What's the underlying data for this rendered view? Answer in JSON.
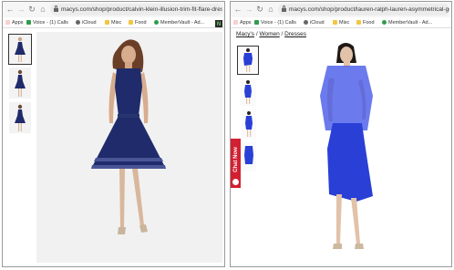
{
  "left_window": {
    "url": "macys.com/shop/product/calvin-klein-illusion-trim-fit-flare-dress",
    "bookmarks": {
      "apps": "Apps",
      "voice": "Voice - (1) Calls",
      "icloud": "iCloud",
      "misc": "Misc",
      "food": "Food",
      "membervault": "MemberVault - Ad..."
    },
    "extension_badge": "N",
    "dress_color": "#1f2b6b"
  },
  "right_window": {
    "url": "macys.com/shop/product/lauren-ralph-lauren-asymmetrical-geor",
    "bookmarks": {
      "apps": "Apps",
      "voice": "Voice - (1) Calls",
      "icloud": "iCloud",
      "misc": "Misc",
      "food": "Food",
      "membervault": "MemberVault - Ad..."
    },
    "breadcrumb": [
      "Macy's",
      "Women",
      "Dresses"
    ],
    "breadcrumb_separator": " / ",
    "chat_label": "Chat Now",
    "dress_color": "#2a3fd6"
  }
}
